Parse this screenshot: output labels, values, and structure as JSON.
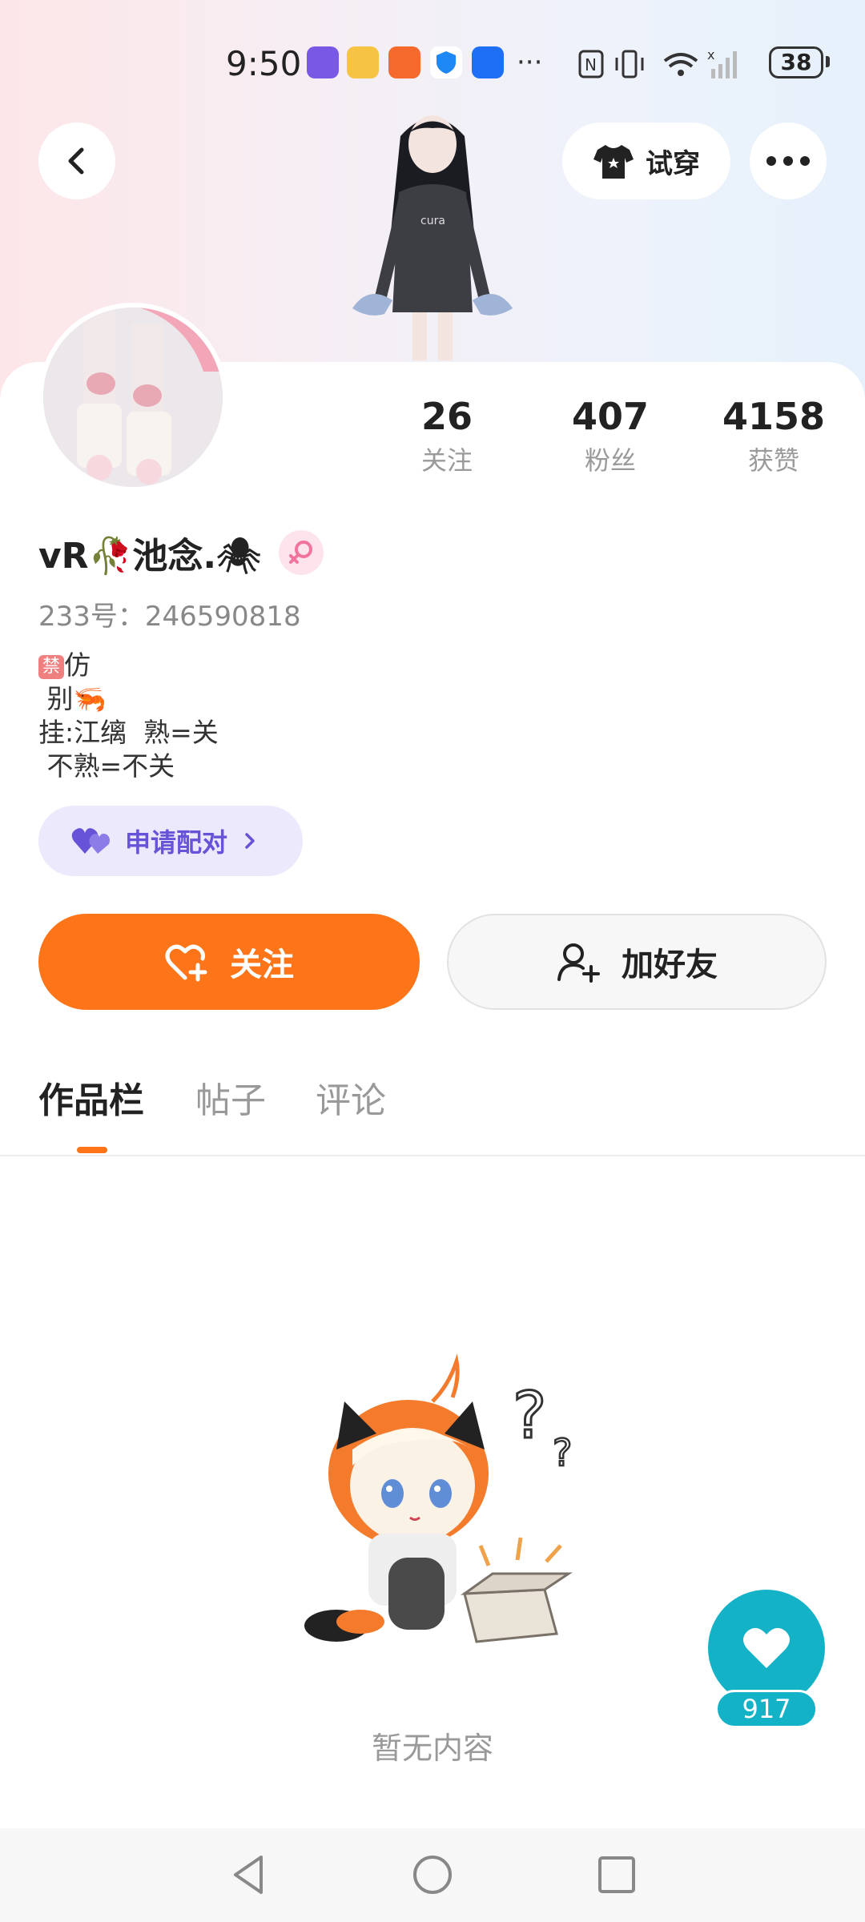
{
  "status_bar": {
    "time": "9:50",
    "battery": "38"
  },
  "header": {
    "tryon_label": "试穿"
  },
  "profile": {
    "username": "vR🥀池念.🕷",
    "id_label": "233号：246590818",
    "bio_line1": "仿",
    "bio_ban": "禁",
    "bio_line2": " 别🦐",
    "bio_line3": "挂:江缡  熟=关",
    "bio_line4": " 不熟=不关"
  },
  "stats": [
    {
      "value": "26",
      "label": "关注"
    },
    {
      "value": "407",
      "label": "粉丝"
    },
    {
      "value": "4158",
      "label": "获赞"
    }
  ],
  "actions": {
    "pair_label": "申请配对",
    "follow_label": "关注",
    "add_friend_label": "加好友"
  },
  "tabs": [
    {
      "label": "作品栏",
      "active": true
    },
    {
      "label": "帖子",
      "active": false
    },
    {
      "label": "评论",
      "active": false
    }
  ],
  "empty": {
    "text": "暂无内容"
  },
  "like_fab": {
    "count": "917"
  },
  "colors": {
    "accent_orange": "#fe7418",
    "pair_purple": "#6753d8",
    "fab_teal": "#14b2c7"
  }
}
